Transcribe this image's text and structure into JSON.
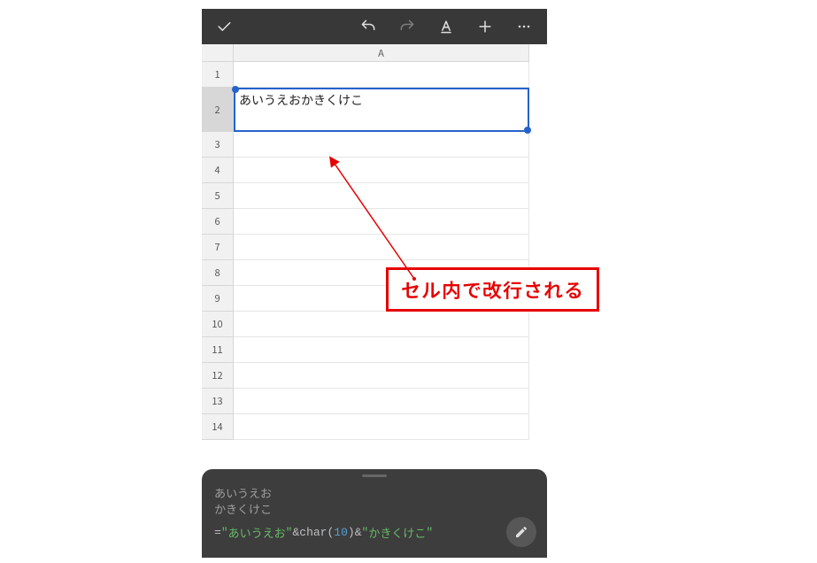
{
  "column_header": "A",
  "rows": [
    "1",
    "2",
    "3",
    "4",
    "5",
    "6",
    "7",
    "8",
    "9",
    "10",
    "11",
    "12",
    "13",
    "14"
  ],
  "selected_row_index": 1,
  "cell_value_line1": "あいうえお",
  "cell_value_line2": "かきくけこ",
  "formula": {
    "eq": "=",
    "q": "\"",
    "str1": "あいうえお",
    "amp": "&",
    "fn": "char",
    "open": "(",
    "num": "10",
    "close": ")",
    "str2": "かきくけこ"
  },
  "callout_text": "セル内で改行される"
}
